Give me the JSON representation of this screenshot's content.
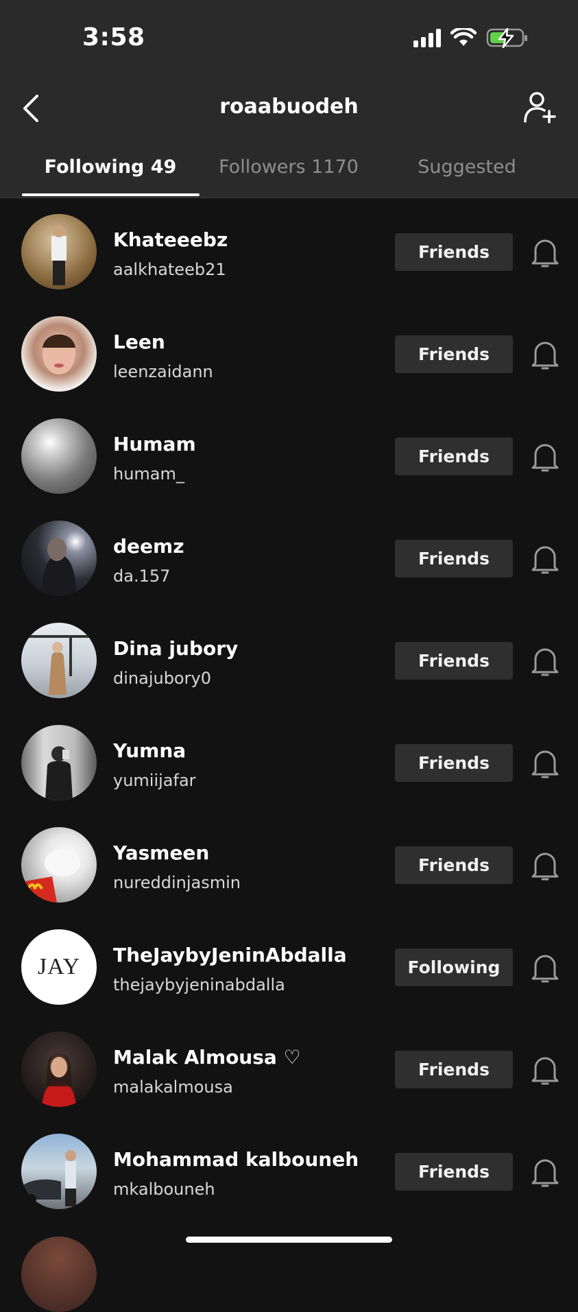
{
  "status_bar": {
    "time": "3:58",
    "icons": [
      "cellular-signal-icon",
      "wifi-icon",
      "battery-charging-icon"
    ]
  },
  "header": {
    "title": "roaabuodeh",
    "back_icon": "chevron-left-icon",
    "action_icon": "add-user-icon"
  },
  "tabs": [
    {
      "label": "Following 49",
      "active": true
    },
    {
      "label": "Followers 1170",
      "active": false
    },
    {
      "label": "Suggested",
      "active": false
    }
  ],
  "users": [
    {
      "name": "Khateeebz",
      "handle": "aalkhateeb21",
      "button": "Friends"
    },
    {
      "name": "Leen",
      "handle": "leenzaidann",
      "button": "Friends"
    },
    {
      "name": "Humam",
      "handle": "humam_",
      "button": "Friends"
    },
    {
      "name": "deemz",
      "handle": "da.157",
      "button": "Friends"
    },
    {
      "name": "Dina jubory",
      "handle": "dinajubory0",
      "button": "Friends"
    },
    {
      "name": "Yumna",
      "handle": "yumiijafar",
      "button": "Friends"
    },
    {
      "name": "Yasmeen",
      "handle": "nureddinjasmin",
      "button": "Friends"
    },
    {
      "name": "TheJaybyJeninAbdalla",
      "handle": "thejaybyjeninabdalla",
      "button": "Following",
      "avatar_text": "JAY"
    },
    {
      "name": "Malak Almousa ♡",
      "handle": "malakalmousa",
      "button": "Friends"
    },
    {
      "name": "Mohammad kalbouneh",
      "handle": "mkalbouneh",
      "button": "Friends"
    }
  ],
  "colors": {
    "background": "#121212",
    "header_background": "#2a2a2a",
    "button_background": "#2f2f2f",
    "inactive_tab_text": "#8e8e8e",
    "battery_charging": "#5fd14b"
  }
}
